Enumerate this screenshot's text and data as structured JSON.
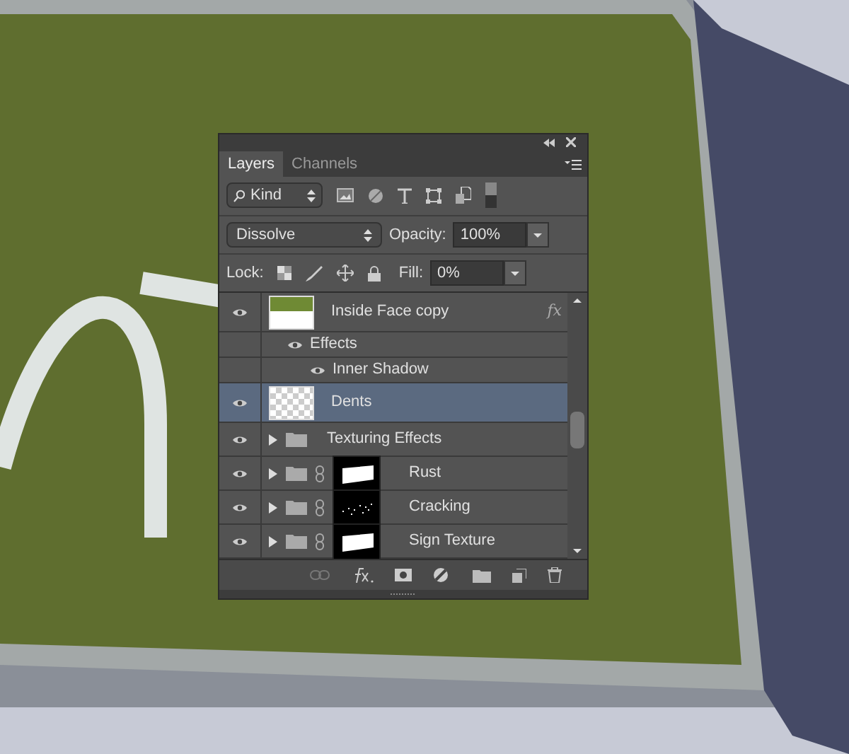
{
  "panel": {
    "tabs": [
      {
        "label": "Layers",
        "selected": true
      },
      {
        "label": "Channels",
        "selected": false
      }
    ],
    "filter": "Kind",
    "blend_mode": "Dissolve",
    "opacity_label": "Opacity:",
    "opacity": "100%",
    "lock_label": "Lock:",
    "fill_label": "Fill:",
    "fill": "0%",
    "layers": [
      {
        "kind": "layer",
        "name": "Inside Face copy",
        "thumb": {
          "kind": "green"
        },
        "fx": "fx",
        "visible": true,
        "selected": false,
        "children": [
          {
            "kind": "effects",
            "name": "Effects",
            "visible": true,
            "children": [
              {
                "kind": "effect",
                "name": "Inner Shadow",
                "visible": true
              }
            ]
          }
        ]
      },
      {
        "kind": "layer",
        "name": "Dents",
        "thumb": {
          "kind": "transparent"
        },
        "visible": true,
        "selected": true
      },
      {
        "kind": "group",
        "name": "Texturing Effects",
        "visible": true,
        "expanded": false,
        "selected": false
      },
      {
        "kind": "group",
        "name": "Rust",
        "mask": {
          "kind": "block"
        },
        "visible": true,
        "expanded": false,
        "selected": false
      },
      {
        "kind": "group",
        "name": "Cracking",
        "mask": {
          "kind": "specks"
        },
        "visible": true,
        "expanded": false,
        "selected": false
      },
      {
        "kind": "group",
        "name": "Sign Texture",
        "mask": {
          "kind": "block"
        },
        "visible": true,
        "expanded": false,
        "selected": false
      }
    ]
  }
}
